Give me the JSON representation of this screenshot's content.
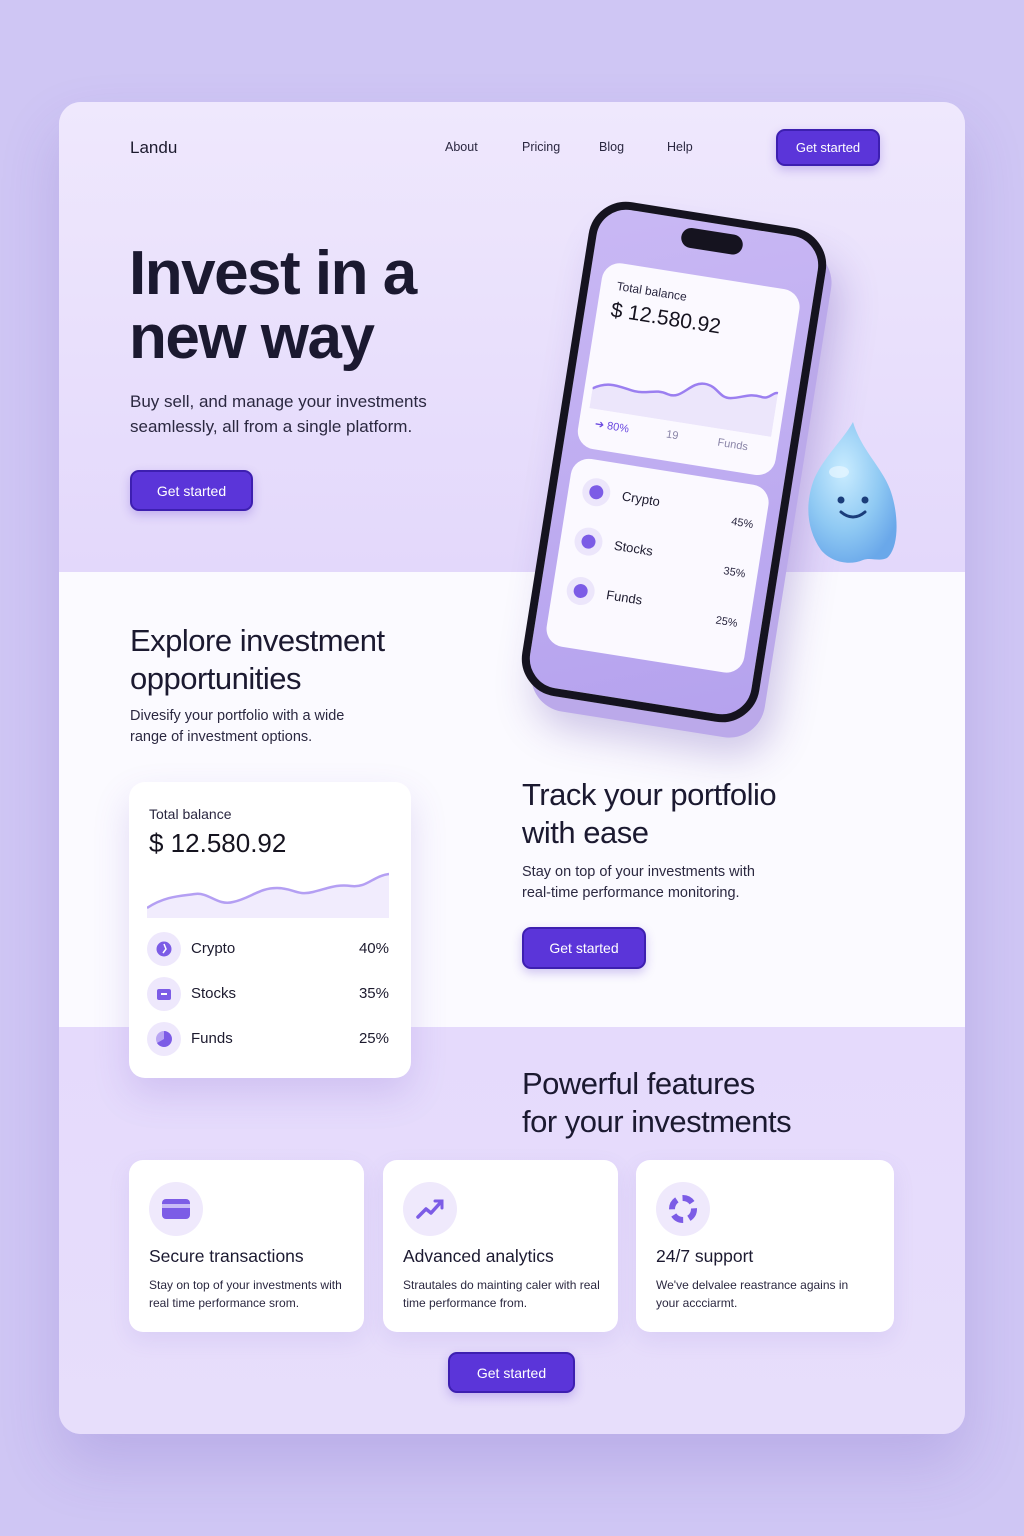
{
  "nav": {
    "logo": "Landu",
    "links": [
      "About",
      "Pricing",
      "Blog",
      "Help"
    ],
    "cta": "Get started"
  },
  "hero": {
    "title_line1": "Invest in a",
    "title_line2": "new way",
    "subtitle": "Buy sell, and manage your investments seamlessly, all from a single platform.",
    "cta": "Get started"
  },
  "phone": {
    "label": "Total balance",
    "amount": "$ 12.580.92",
    "stat1": "80%",
    "stat2": "19",
    "stat3": "Funds",
    "rows": [
      {
        "name": "Crypto",
        "pct": "45%"
      },
      {
        "name": "Stocks",
        "pct": "35%"
      },
      {
        "name": "Funds",
        "pct": "25%"
      }
    ]
  },
  "explore": {
    "title_line1": "Explore investment",
    "title_line2": "opportunities",
    "text_line1": "Divesify your portfolio with a wide",
    "text_line2": "range of investment options."
  },
  "balance_card": {
    "label": "Total balance",
    "amount": "$ 12.580.92",
    "rows": [
      {
        "name": "Crypto",
        "pct": "40%"
      },
      {
        "name": "Stocks",
        "pct": "35%"
      },
      {
        "name": "Funds",
        "pct": "25%"
      }
    ]
  },
  "track": {
    "title_line1": "Track your portfolio",
    "title_line2": "with ease",
    "text_line1": "Stay on top of your investments with",
    "text_line2": "real-time performance monitoring.",
    "cta": "Get started"
  },
  "features": {
    "title_line1": "Powerful features",
    "title_line2": "for your investments",
    "cards": [
      {
        "icon": "credit-card-icon",
        "title": "Secure transactions",
        "text": "Stay on top of your investments with real time performance srom."
      },
      {
        "icon": "trend-up-icon",
        "title": "Advanced analytics",
        "text": "Strautales do mainting caler with real time performance from."
      },
      {
        "icon": "lifebuoy-icon",
        "title": "24/7 support",
        "text": "We've delvalee reastrance agains in your accciarmt."
      }
    ],
    "cta": "Get started"
  },
  "colors": {
    "accent": "#5b35d9",
    "background": "#cfc6f4",
    "chart_line": "#9b7ff0"
  }
}
